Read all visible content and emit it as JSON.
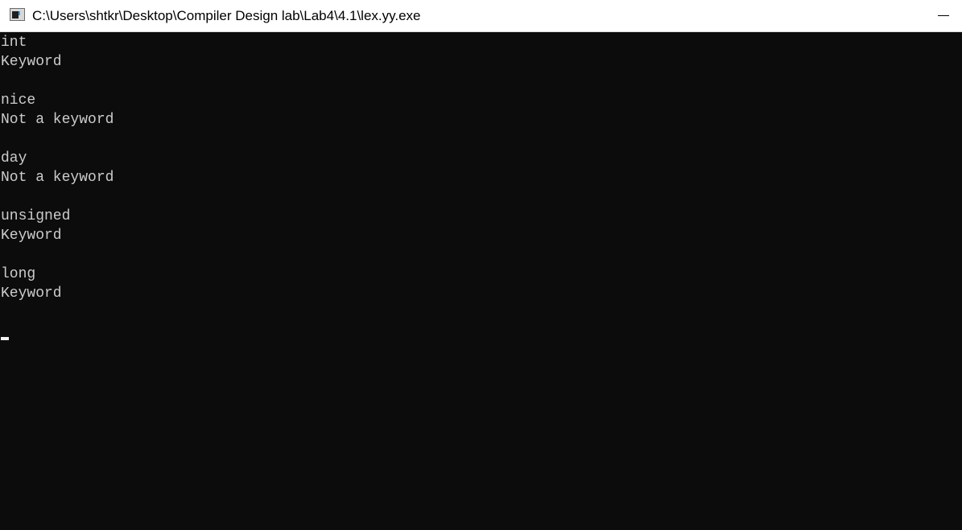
{
  "window": {
    "title": "C:\\Users\\shtkr\\Desktop\\Compiler Design lab\\Lab4\\4.1\\lex.yy.exe",
    "icon": "console-app-icon",
    "controls": [
      "minimize-icon"
    ]
  },
  "console": {
    "lines": [
      "int",
      "Keyword",
      "",
      "nice",
      "Not a keyword",
      "",
      "day",
      "Not a keyword",
      "",
      "unsigned",
      "Keyword",
      "",
      "long",
      "Keyword"
    ],
    "background": "#0c0c0c",
    "foreground": "#cccccc"
  }
}
